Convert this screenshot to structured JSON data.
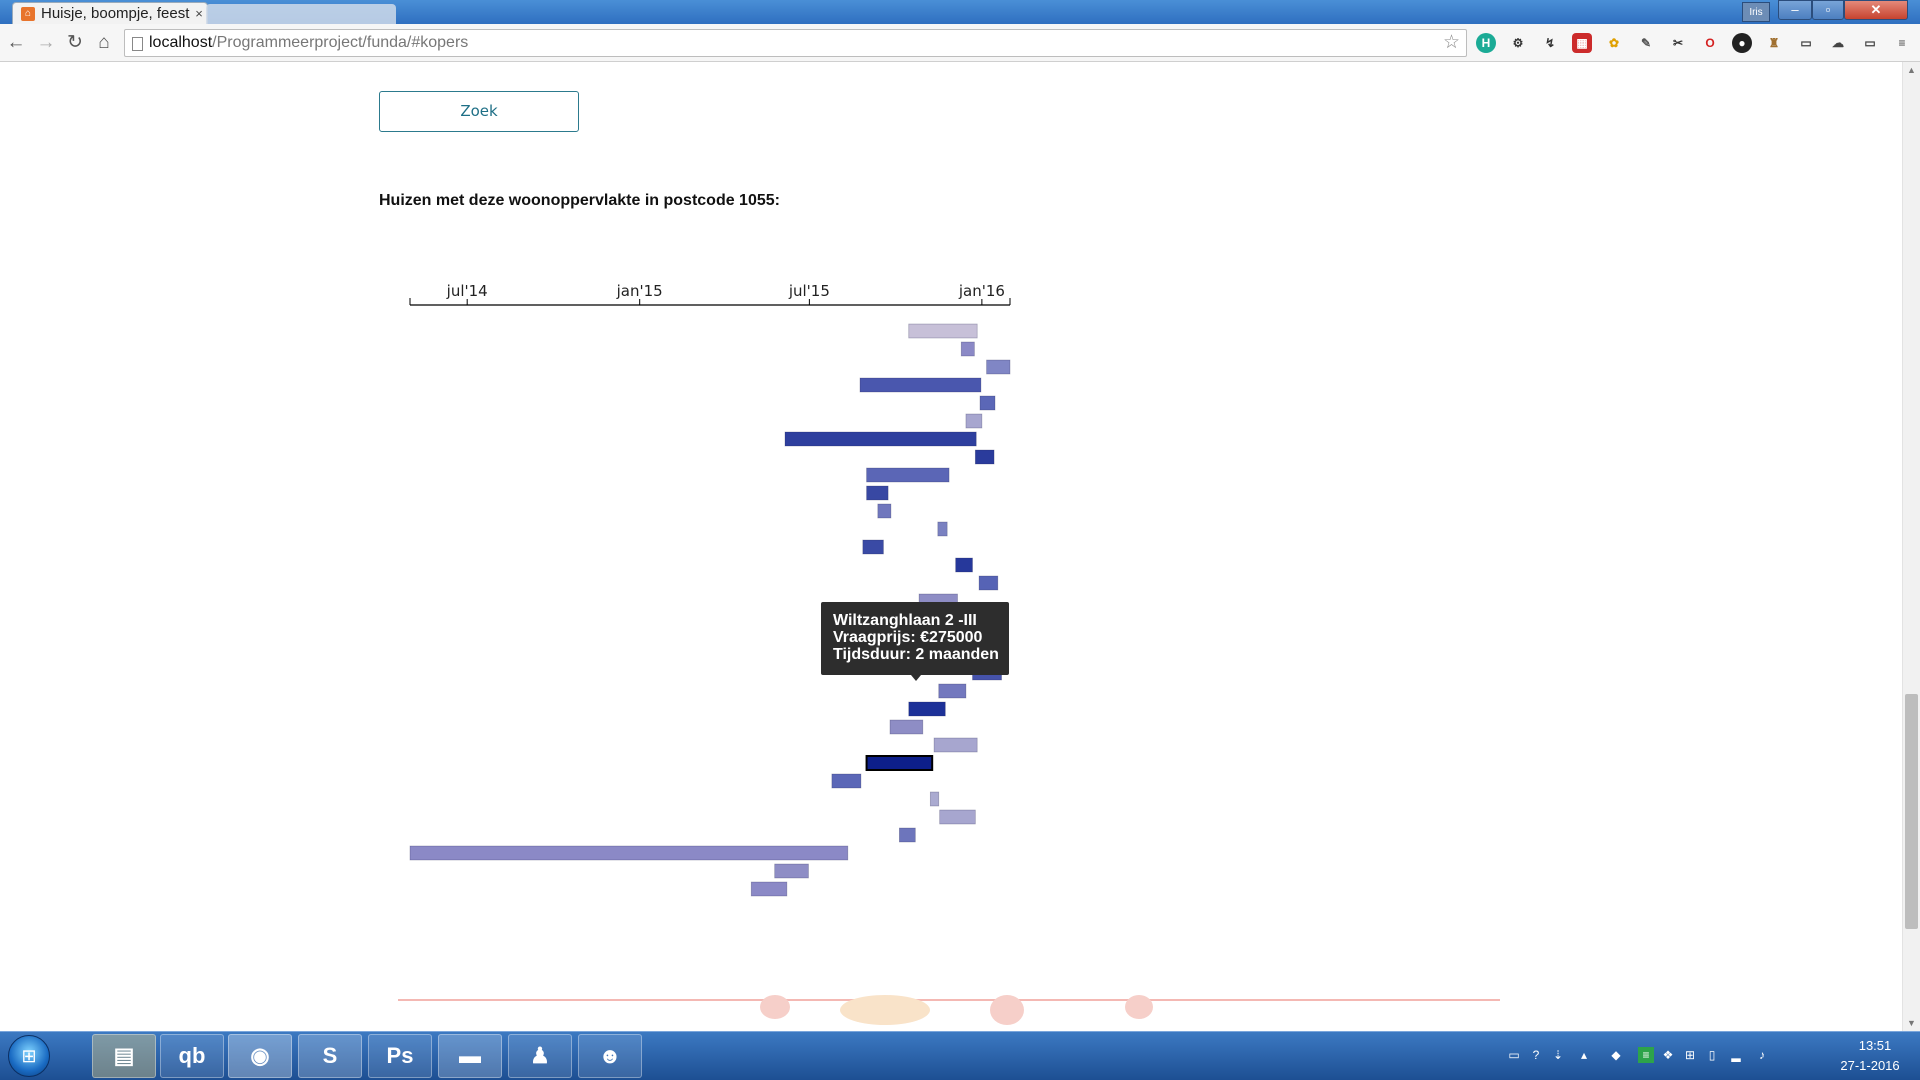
{
  "browser": {
    "tab_title": "Huisje, boompje, feest",
    "tab_close": "×",
    "url_host": "localhost",
    "url_path": "/Programmeerproject/funda/#kopers",
    "user_badge": "Iris"
  },
  "page": {
    "search_button_label": "Zoek",
    "chart_heading": "Huizen met deze woonoppervlakte in postcode 1055:"
  },
  "tooltip": {
    "address": "Wiltzanghlaan 2 -III",
    "price": "Vraagprijs: €275000",
    "duration": "Tijdsduur: 2 maanden"
  },
  "chart_data": {
    "type": "gantt",
    "title": "Huizen met deze woonoppervlakte in postcode 1055:",
    "x_axis": {
      "type": "time",
      "domain": [
        "2014-05-01",
        "2016-01-31"
      ],
      "ticks": [
        {
          "date": "2014-07-01",
          "label": "jul'14"
        },
        {
          "date": "2015-01-01",
          "label": "jan'15"
        },
        {
          "date": "2015-07-01",
          "label": "jul'15"
        },
        {
          "date": "2016-01-01",
          "label": "jan'16"
        }
      ]
    },
    "bars": [
      {
        "start": "2015-10-15",
        "end": "2015-12-27",
        "color": "#c7c0d8"
      },
      {
        "start": "2015-12-10",
        "end": "2015-12-24",
        "color": "#8b89c6"
      },
      {
        "start": "2016-01-06",
        "end": "2016-01-31",
        "color": "#8086c5"
      },
      {
        "start": "2015-08-24",
        "end": "2015-12-31",
        "color": "#4a57ae"
      },
      {
        "start": "2015-12-30",
        "end": "2016-01-15",
        "color": "#5b67b7"
      },
      {
        "start": "2015-12-15",
        "end": "2016-01-01",
        "color": "#a7a6cf"
      },
      {
        "start": "2015-06-05",
        "end": "2015-12-26",
        "color": "#2e3f9e"
      },
      {
        "start": "2015-12-25",
        "end": "2016-01-14",
        "color": "#2a3b9c"
      },
      {
        "start": "2015-08-31",
        "end": "2015-11-27",
        "color": "#5b66b6"
      },
      {
        "start": "2015-08-31",
        "end": "2015-09-23",
        "color": "#3848a3"
      },
      {
        "start": "2015-09-12",
        "end": "2015-09-26",
        "color": "#7077bd"
      },
      {
        "start": "2015-11-15",
        "end": "2015-11-25",
        "color": "#7a81c1"
      },
      {
        "start": "2015-08-27",
        "end": "2015-09-18",
        "color": "#3a4aa5"
      },
      {
        "start": "2015-12-04",
        "end": "2015-12-22",
        "color": "#26389b"
      },
      {
        "start": "2015-12-29",
        "end": "2016-01-18",
        "color": "#5663b5"
      },
      {
        "start": "2015-10-26",
        "end": "2015-12-06",
        "color": "#8e8dc5"
      },
      {
        "start": "2015-10-26",
        "end": "2015-11-20",
        "color": "#4a56ae"
      },
      {
        "start": "2015-10-26",
        "end": "2015-11-27",
        "color": "#152c94"
      },
      {
        "start": "2015-12-25",
        "end": "2016-01-22",
        "color": "#6a71ba"
      },
      {
        "start": "2015-12-22",
        "end": "2016-01-22",
        "color": "#4653ab"
      },
      {
        "start": "2015-11-16",
        "end": "2015-12-15",
        "color": "#7378be"
      },
      {
        "start": "2015-10-15",
        "end": "2015-11-23",
        "color": "#1d3198"
      },
      {
        "start": "2015-09-25",
        "end": "2015-10-30",
        "color": "#8e8dc5"
      },
      {
        "start": "2015-11-11",
        "end": "2015-12-27",
        "color": "#a7a6cf"
      },
      {
        "start": "2015-08-31",
        "end": "2015-11-09",
        "color": "#0d1f8a",
        "highlighted": true
      },
      {
        "start": "2015-07-25",
        "end": "2015-08-25",
        "color": "#5b67b7"
      },
      {
        "start": "2015-11-07",
        "end": "2015-11-16",
        "color": "#aaaad0"
      },
      {
        "start": "2015-11-17",
        "end": "2015-12-25",
        "color": "#a7a6cf"
      },
      {
        "start": "2015-10-05",
        "end": "2015-10-22",
        "color": "#6d75bc"
      },
      {
        "start": "2014-05-01",
        "end": "2015-08-11",
        "color": "#8b89c6"
      },
      {
        "start": "2015-05-25",
        "end": "2015-06-30",
        "color": "#8e8dc5"
      },
      {
        "start": "2015-04-30",
        "end": "2015-06-07",
        "color": "#8b89c6"
      }
    ]
  },
  "taskbar": {
    "clock_time": "13:51",
    "clock_date": "27-1-2016",
    "apps": [
      "file-explorer",
      "qbittorrent",
      "chrome",
      "sublime-text",
      "photoshop",
      "command-prompt",
      "gaming-app",
      "github"
    ]
  }
}
